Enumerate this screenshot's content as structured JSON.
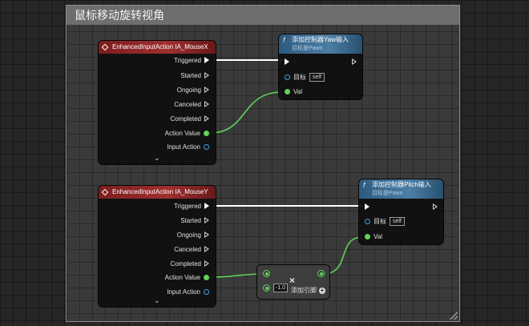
{
  "comment": {
    "title": "鼠标移动旋转视角"
  },
  "node_mousex": {
    "title": "EnhancedInputAction IA_MouseX",
    "pins": [
      "Triggered",
      "Started",
      "Ongoing",
      "Canceled",
      "Completed",
      "Action Value",
      "Input Action"
    ],
    "expand": "⌄"
  },
  "node_mousey": {
    "title": "EnhancedInputAction IA_MouseY",
    "pins": [
      "Triggered",
      "Started",
      "Ongoing",
      "Canceled",
      "Completed",
      "Action Value",
      "Input Action"
    ],
    "expand": "⌄"
  },
  "node_yaw": {
    "glyph": "f",
    "title": "添加控制器Yaw输入",
    "subtitle": "目标是Pawn",
    "target_label": "目标",
    "target_value": "self",
    "val_label": "Val"
  },
  "node_pitch": {
    "glyph": "f",
    "title": "添加控制器Pitch输入",
    "subtitle": "目标是Pawn",
    "target_label": "目标",
    "target_value": "self",
    "val_label": "Val"
  },
  "node_multiply": {
    "operator": "×",
    "value": "-1.0",
    "add_pin_label": "添加引脚",
    "add_icon": "+"
  },
  "colors": {
    "event_header": "#9e2f2f",
    "function_header": "#4d7fa6",
    "float_pin": "#5fd35a",
    "object_pin": "#3aa6e6",
    "exec_wire": "#ffffff"
  }
}
